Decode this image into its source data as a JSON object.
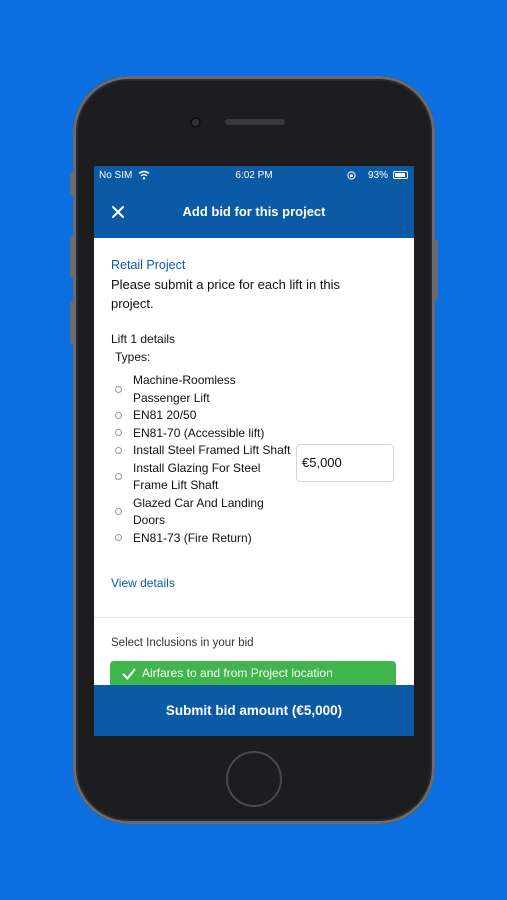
{
  "status_bar": {
    "carrier": "No SIM",
    "time": "6:02 PM",
    "battery": "93%"
  },
  "header": {
    "title": "Add bid for this project",
    "close_icon": "close-icon"
  },
  "project": {
    "name": "Retail Project",
    "instruction": "Please submit a price for each lift in this project."
  },
  "lift": {
    "title": "Lift 1 details",
    "types_label": "Types:",
    "types": [
      "Machine-Roomless Passenger Lift",
      "EN81 20/50",
      "EN81-70 (Accessible lift)",
      "Install Steel Framed Lift Shaft",
      "Install Glazing For Steel Frame Lift Shaft",
      "Glazed Car And Landing Doors",
      "EN81-73 (Fire Return)"
    ],
    "price": "€5,000",
    "view_details": "View details"
  },
  "inclusions": {
    "label": "Select Inclusions in your bid",
    "items": [
      "Airfares to and from Project location"
    ]
  },
  "submit_label": "Submit bid amount (€5,000)",
  "colors": {
    "background": "#0b6fdf",
    "primary": "#0b5aa6",
    "success": "#3fb54c"
  }
}
